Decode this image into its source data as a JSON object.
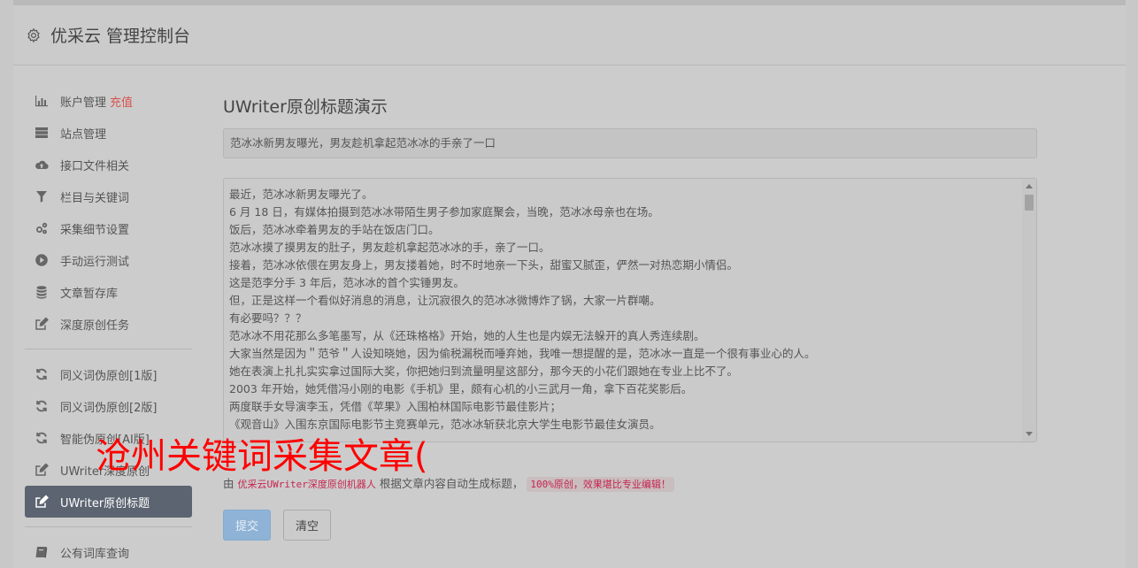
{
  "header": {
    "title": "优采云 管理控制台",
    "icon": "gear-icon"
  },
  "sidebar": {
    "items": [
      {
        "label": "账户管理",
        "extra": "充值",
        "icon": "bar-chart-icon"
      },
      {
        "label": "站点管理",
        "icon": "server-icon"
      },
      {
        "label": "接口文件相关",
        "icon": "cloud-upload-icon"
      },
      {
        "label": "栏目与关键词",
        "icon": "filter-icon"
      },
      {
        "label": "采集细节设置",
        "icon": "gears-icon"
      },
      {
        "label": "手动运行测试",
        "icon": "play-circle-icon"
      },
      {
        "label": "文章暂存库",
        "icon": "database-icon"
      },
      {
        "label": "深度原创任务",
        "icon": "edit-icon"
      },
      {
        "label": "同义词伪原创[1版]",
        "icon": "refresh-icon"
      },
      {
        "label": "同义词伪原创[2版]",
        "icon": "refresh-icon"
      },
      {
        "label": "智能伪原创[AI版]",
        "icon": "refresh-icon"
      },
      {
        "label": "UWriter深度原创",
        "icon": "edit-icon"
      },
      {
        "label": "UWriter原创标题",
        "icon": "edit-icon"
      },
      {
        "label": "公有词库查询",
        "icon": "book-icon"
      }
    ]
  },
  "main": {
    "page_title": "UWriter原创标题演示",
    "title_input_value": "范冰冰新男友曝光，男友趁机拿起范冰冰的手亲了一口",
    "content_lines": [
      "最近，范冰冰新男友曝光了。",
      "6 月 18 日，有媒体拍摄到范冰冰带陌生男子参加家庭聚会，当晚，范冰冰母亲也在场。",
      "饭后，范冰冰牵着男友的手站在饭店门口。",
      "范冰冰摸了摸男友的肚子，男友趁机拿起范冰冰的手，亲了一口。",
      "接着，范冰冰依偎在男友身上，男友搂着她，时不时地亲一下头，甜蜜又腻歪，俨然一对热恋期小情侣。",
      "这是范李分手 3 年后，范冰冰的首个实锤男友。",
      "但，正是这样一个看似好消息的消息，让沉寂很久的范冰冰微博炸了锅，大家一片群嘲。",
      "有必要吗？？？",
      "范冰冰不用花那么多笔墨写，从《还珠格格》开始，她的人生也是内娱无法躲开的真人秀连续剧。",
      "大家当然是因为＂范爷＂人设知晓她，因为偷税漏税而唾弃她，我唯一想提醒的是，范冰冰一直是一个很有事业心的人。",
      "她在表演上扎扎实实拿过国际大奖，你把她归到流量明星这部分，那今天的小花们跟她在专业上比不了。",
      "2003 年开始，她凭借冯小刚的电影《手机》里，颇有心机的小三武月一角，拿下百花奖影后。",
      "两度联手女导演李玉，凭借《苹果》入围柏林国际电影节最佳影片；",
      "《观音山》入围东京国际电影节主竞赛单元，范冰冰斩获北京大学生电影节最佳女演员。"
    ],
    "note_prefix": "由",
    "note_code": "优采云UWriter深度原创机器人",
    "note_middle": "根据文章内容自动生成标题，",
    "note_highlight": "100%原创，效果堪比专业编辑！",
    "submit_label": "提交",
    "clear_label": "清空"
  },
  "watermark": "沧州关键词采集文章(",
  "colors": {
    "accent_red": "#d9534f",
    "active_item_bg": "#5b6470",
    "submit_bg": "#8eb3d6",
    "watermark": "#ff0000"
  }
}
